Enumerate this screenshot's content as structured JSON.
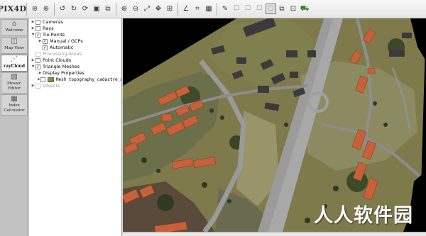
{
  "app": {
    "logo": "PIX4D"
  },
  "toolbar": {
    "buttons": [
      {
        "name": "view-all-icon",
        "glyph": "⊛"
      },
      {
        "name": "crosshair-icon",
        "glyph": "⊕"
      },
      {
        "name": "rotate-left-icon",
        "glyph": "↺"
      },
      {
        "name": "rotate-right-icon",
        "glyph": "↻"
      },
      {
        "name": "refresh-icon",
        "glyph": "⟳"
      },
      {
        "name": "save-view-icon",
        "glyph": "▣"
      },
      {
        "name": "load-view-icon",
        "glyph": "⧉"
      },
      {
        "name": "zoom-in-icon",
        "glyph": "⊕"
      },
      {
        "name": "zoom-out-icon",
        "glyph": "⊖"
      },
      {
        "name": "zoom-extent-icon",
        "glyph": "⤢"
      },
      {
        "name": "fit-icon",
        "glyph": "✥"
      },
      {
        "name": "measure-icon",
        "glyph": "⊞"
      },
      {
        "name": "polyline-icon",
        "glyph": "∠"
      },
      {
        "name": "volume-icon",
        "glyph": "⌗"
      },
      {
        "name": "grid-icon",
        "glyph": "▦"
      },
      {
        "name": "brush-icon",
        "glyph": "✎"
      },
      {
        "name": "box-1-icon",
        "glyph": "☐"
      },
      {
        "name": "box-2-icon",
        "glyph": "☐"
      },
      {
        "name": "box-3-icon",
        "glyph": "☐"
      },
      {
        "name": "box-active-icon",
        "glyph": "▢"
      },
      {
        "name": "layers-icon",
        "glyph": "⧉"
      },
      {
        "name": "export-icon",
        "glyph": "⊡"
      },
      {
        "name": "flythrough-icon",
        "glyph": "⛟"
      }
    ]
  },
  "sidebar": {
    "items": [
      {
        "label": "Welcome",
        "icon": "home-icon",
        "glyph": "⌂"
      },
      {
        "label": "Map View",
        "icon": "map-icon",
        "glyph": "◫"
      },
      {
        "label": "rayCloud",
        "icon": "raycloud-icon",
        "glyph": "⋰"
      },
      {
        "label": "Mosaic Editor",
        "icon": "mosaic-icon",
        "glyph": "▧"
      },
      {
        "label": "Index Calculator",
        "icon": "index-icon",
        "glyph": "▦"
      }
    ],
    "active": "rayCloud"
  },
  "layers": {
    "rows": [
      {
        "label": "Cameras",
        "arrow": "▶",
        "checked": false,
        "indent": 0,
        "disabled": false
      },
      {
        "label": "Rays",
        "arrow": "▶",
        "checked": false,
        "indent": 0,
        "disabled": false
      },
      {
        "label": "Tie Points",
        "arrow": "▼",
        "checked": true,
        "indent": 0,
        "disabled": false
      },
      {
        "label": "Manual / GCPs",
        "arrow": "▶",
        "checked": true,
        "indent": 1,
        "disabled": false
      },
      {
        "label": "Automatic",
        "arrow": "",
        "checked": true,
        "indent": 1,
        "disabled": false
      },
      {
        "label": "Processing Areas",
        "arrow": "",
        "checked": false,
        "indent": 0,
        "disabled": true
      },
      {
        "label": "Point Clouds",
        "arrow": "▶",
        "checked": false,
        "indent": 0,
        "disabled": false
      },
      {
        "label": "Triangle Meshes",
        "arrow": "▼",
        "checked": true,
        "indent": 0,
        "disabled": false
      },
      {
        "label": "Display Properties",
        "arrow": "▶",
        "checked": null,
        "indent": 1,
        "disabled": false
      },
      {
        "label": "Mesh topography_cadastre_swi",
        "arrow": "▶",
        "checked": false,
        "indent": 1,
        "disabled": false,
        "mesh": true
      },
      {
        "label": "Objects",
        "arrow": "▶",
        "checked": false,
        "indent": 0,
        "disabled": true
      }
    ]
  },
  "watermark": {
    "text": "人人软件园"
  },
  "colors": {
    "roof": "#c8603a",
    "grass": "#8a8a5a",
    "road": "#9a9a9a",
    "background": "#000000"
  }
}
